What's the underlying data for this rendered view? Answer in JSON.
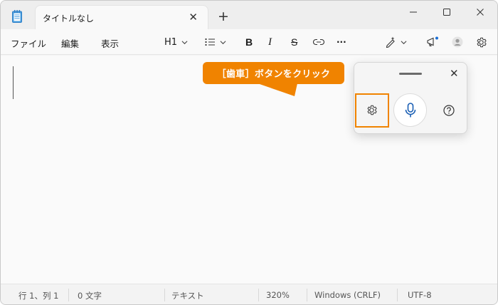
{
  "window": {
    "tab_title": "タイトルなし",
    "tab_close": "✕",
    "new_tab": "+"
  },
  "menu": {
    "file": "ファイル",
    "edit": "編集",
    "view": "表示"
  },
  "toolbar": {
    "heading": "H1",
    "bold": "B",
    "italic": "I",
    "strike": "S",
    "more": "···"
  },
  "voice_panel": {
    "close": "✕"
  },
  "callout": {
    "text": "［歯車］ボタンをクリック",
    "color": "#f08300"
  },
  "status": {
    "position": "行 1、列 1",
    "chars": "0 文字",
    "format": "テキスト",
    "zoom": "320%",
    "line_ending": "Windows (CRLF)",
    "encoding": "UTF-8"
  }
}
